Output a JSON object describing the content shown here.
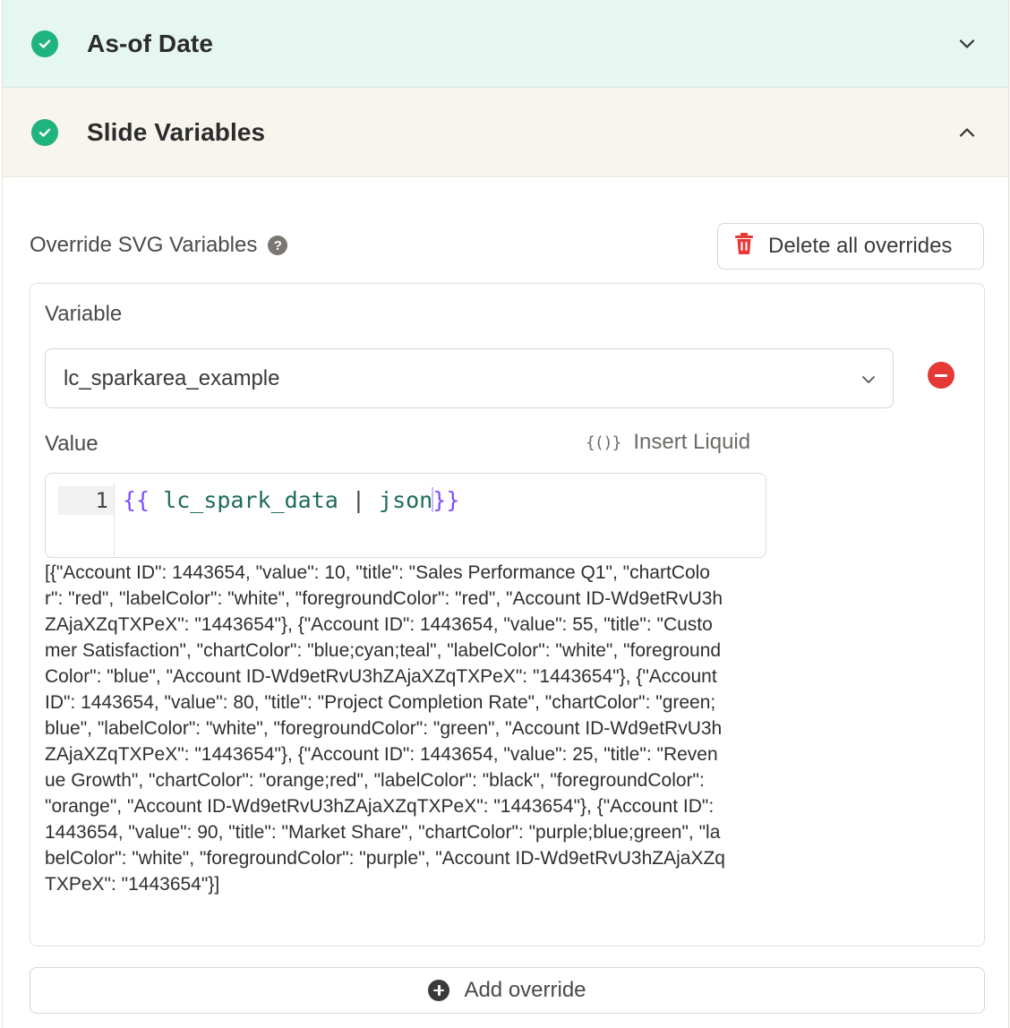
{
  "sections": {
    "asof": {
      "title": "As-of Date",
      "status": "complete",
      "expanded": false
    },
    "slide_variables": {
      "title": "Slide Variables",
      "status": "complete",
      "expanded": true
    }
  },
  "override": {
    "label": "Override SVG Variables",
    "help_icon": "?",
    "delete_all_label": "Delete all overrides"
  },
  "variable_card": {
    "variable_label": "Variable",
    "selected_variable": "lc_sparkarea_example",
    "value_label": "Value",
    "insert_liquid_icon": "{()}",
    "insert_liquid_label": "Insert Liquid",
    "editor": {
      "line_number": "1",
      "open_brace": "{{",
      "variable": "lc_spark_data",
      "pipe": "|",
      "filter": "json",
      "close_brace_a": "}",
      "close_brace_b": "}"
    },
    "preview_text": "[{\"Account ID\": 1443654, \"value\": 10, \"title\": \"Sales Performance Q1\", \"chartColor\": \"red\", \"labelColor\": \"white\", \"foregroundColor\": \"red\", \"Account ID-Wd9etRvU3hZAjaXZqTXPeX\": \"1443654\"}, {\"Account ID\": 1443654, \"value\": 55, \"title\": \"Customer Satisfaction\", \"chartColor\": \"blue;cyan;teal\", \"labelColor\": \"white\", \"foregroundColor\": \"blue\", \"Account ID-Wd9etRvU3hZAjaXZqTXPeX\": \"1443654\"}, {\"Account ID\": 1443654, \"value\": 80, \"title\": \"Project Completion Rate\", \"chartColor\": \"green;blue\", \"labelColor\": \"white\", \"foregroundColor\": \"green\", \"Account ID-Wd9etRvU3hZAjaXZqTXPeX\": \"1443654\"}, {\"Account ID\": 1443654, \"value\": 25, \"title\": \"Revenue Growth\", \"chartColor\": \"orange;red\", \"labelColor\": \"black\", \"foregroundColor\": \"orange\", \"Account ID-Wd9etRvU3hZAjaXZqTXPeX\": \"1443654\"}, {\"Account ID\": 1443654, \"value\": 90, \"title\": \"Market Share\", \"chartColor\": \"purple;blue;green\", \"labelColor\": \"white\", \"foregroundColor\": \"purple\", \"Account ID-Wd9etRvU3hZAjaXZqTXPeX\": \"1443654\"}]"
  },
  "add_override_label": "Add override",
  "colors": {
    "success": "#1fb37d",
    "danger": "#e53935",
    "liquid_brace": "#7c4dff",
    "liquid_ident": "#1e6b5a",
    "asof_header_bg": "#e6f6f1",
    "slide_header_bg": "#f8f4ee"
  }
}
